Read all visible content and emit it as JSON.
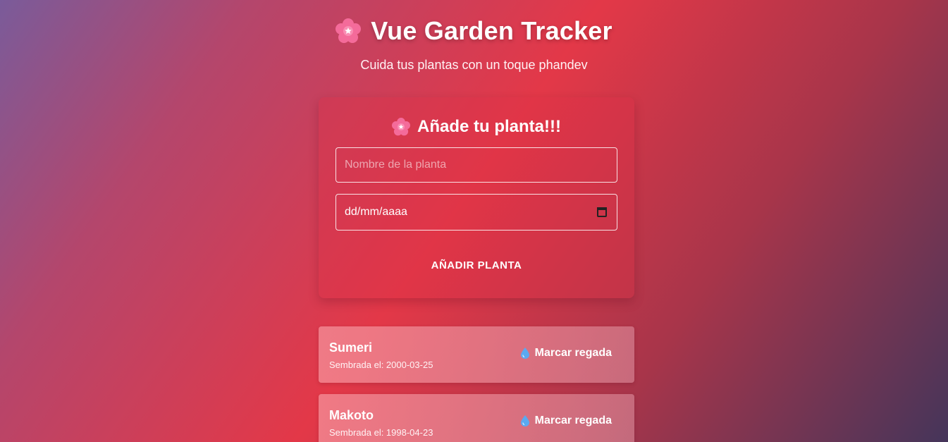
{
  "header": {
    "title": "Vue Garden Tracker",
    "subtitle": "Cuida tus plantas con un toque phandev",
    "icon": "cherry-blossom-icon"
  },
  "form": {
    "title": "Añade tu planta!!!",
    "icon": "cherry-blossom-icon",
    "name_placeholder": "Nombre de la planta",
    "name_value": "",
    "date_placeholder": "dd/mm/aaaa",
    "date_icon": "calendar-icon",
    "submit_label": "AÑADIR PLANTA"
  },
  "plants": [
    {
      "name": "Sumeri",
      "sown": "Sembrada el: 2000-03-25",
      "action_label": "Marcar regada",
      "action_icon": "water-drop-icon"
    },
    {
      "name": "Makoto",
      "sown": "Sembrada el: 1998-04-23",
      "action_label": "Marcar regada",
      "action_icon": "water-drop-icon"
    }
  ],
  "colors": {
    "background_start": "#7a5b9a",
    "background_mid": "#e33848",
    "background_end": "#45355a",
    "text": "#ffffff"
  }
}
